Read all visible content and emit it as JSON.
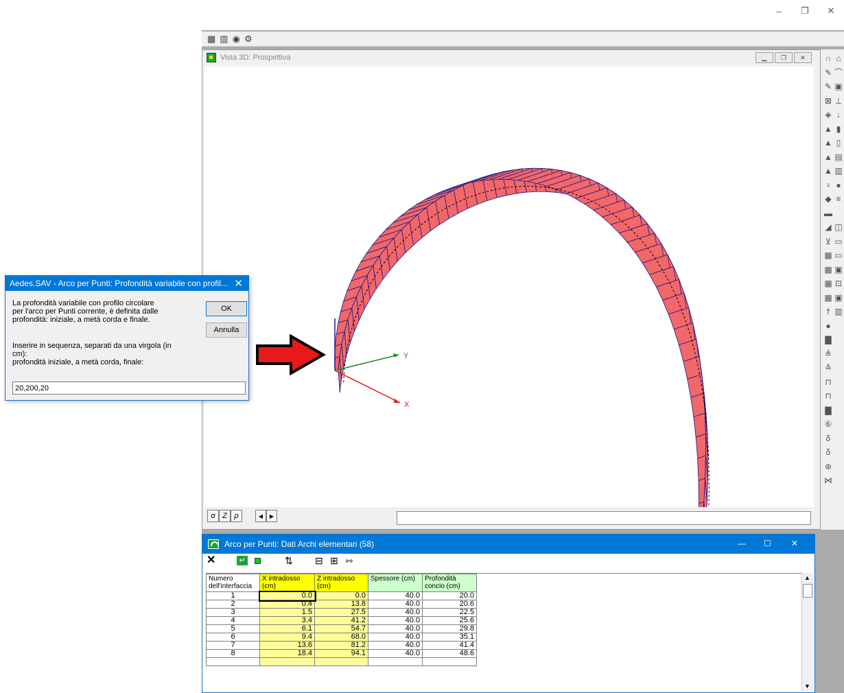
{
  "main_window": {
    "minimize_icon": "minimize-icon",
    "restore_icon": "restore-icon",
    "close_icon": "close-icon"
  },
  "view3d": {
    "title": "Vista 3D: Prospettiva",
    "axis_x": "X",
    "axis_y": "Y",
    "mode_buttons": [
      "α",
      "Z",
      "ρ"
    ],
    "nav_buttons": [
      "◀",
      "▶"
    ]
  },
  "dialog": {
    "title": "Aedes.SAV - Arco per Punti: Profondità variabile con profil...",
    "message1": "La profondità variabile con profilo circolare\nper l'arco per Punti corrente, è definita dalle\nprofondità: iniziale, a metà corda e finale.",
    "message2": "Inserire in sequenza, separati da una virgola (in\ncm):\nprofondità iniziale, a metà corda, finale:",
    "ok_label": "OK",
    "cancel_label": "Annulla",
    "input_value": "20,200,20"
  },
  "table_window": {
    "title": "Arco per Punti: Dati Archi elementari (58)",
    "columns": [
      "Numero dell'interfaccia",
      "X intradosso (cm)",
      "Z intradosso (cm)",
      "Spessore (cm)",
      "Profondità concio (cm)"
    ],
    "header_colors": {
      "x": "#ffff00",
      "z": "#ffff00",
      "spessore": "#ccffcc",
      "profondita": "#ccffcc"
    },
    "rows": [
      [
        "1",
        "0.0",
        "0.0",
        "40.0",
        "20.0"
      ],
      [
        "2",
        "0.4",
        "13.8",
        "40.0",
        "20.6"
      ],
      [
        "3",
        "1.5",
        "27.5",
        "40.0",
        "22.5"
      ],
      [
        "4",
        "3.4",
        "41.2",
        "40.0",
        "25.6"
      ],
      [
        "5",
        "6.1",
        "54.7",
        "40.0",
        "29.8"
      ],
      [
        "6",
        "9.4",
        "68.0",
        "40.0",
        "35.1"
      ],
      [
        "7",
        "13.6",
        "81.2",
        "40.0",
        "41.4"
      ],
      [
        "8",
        "18.4",
        "94.1",
        "40.0",
        "48.6"
      ]
    ]
  },
  "colors": {
    "arch_fill": "#f26767",
    "arch_edge": "#1a1a8c",
    "accent_blue": "#0078d7",
    "arrow_red": "#e8191c"
  }
}
